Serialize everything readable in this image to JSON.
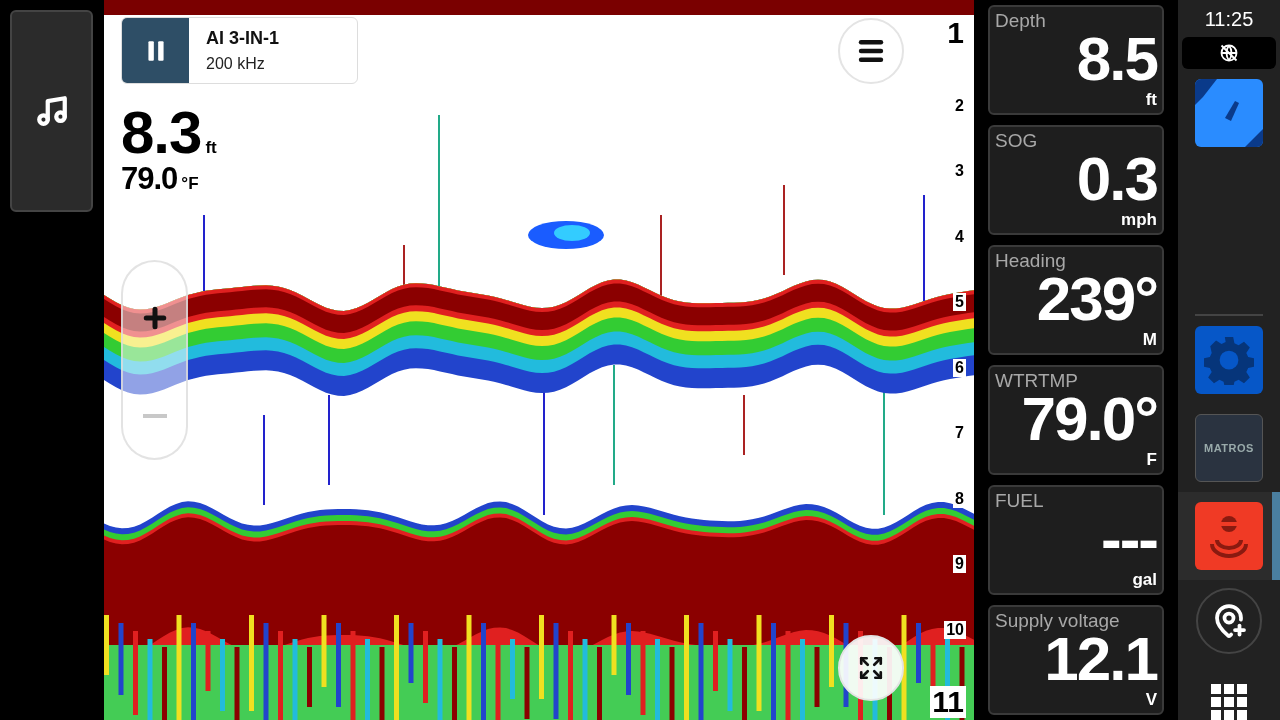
{
  "sonar": {
    "source": {
      "title": "AI 3-IN-1",
      "frequency": "200 kHz"
    },
    "depth": {
      "value": "8.3",
      "unit": "ft"
    },
    "temperature": {
      "value": "79.0",
      "unit": "°F"
    },
    "zoom": {
      "zoom_out_disabled": true
    },
    "scale": [
      "1",
      "2",
      "3",
      "4",
      "5",
      "6",
      "7",
      "8",
      "9",
      "10",
      "11"
    ]
  },
  "gauges": [
    {
      "label": "Depth",
      "value": "8.5",
      "unit": "ft"
    },
    {
      "label": "SOG",
      "value": "0.3",
      "unit": "mph"
    },
    {
      "label": "Heading",
      "value": "239°",
      "unit": "M"
    },
    {
      "label": "WTRTMP",
      "value": "79.0°",
      "unit": "F"
    },
    {
      "label": "FUEL",
      "value": "---",
      "unit": "gal"
    },
    {
      "label": "Supply voltage",
      "value": "12.1",
      "unit": "V"
    }
  ],
  "rail": {
    "time": "11:25",
    "apps": [
      {
        "kind": "chart",
        "selected": false
      },
      {
        "kind": "settings",
        "selected": false
      },
      {
        "kind": "matros",
        "label": "MATROS",
        "selected": false
      },
      {
        "kind": "sonar",
        "selected": true
      }
    ]
  }
}
